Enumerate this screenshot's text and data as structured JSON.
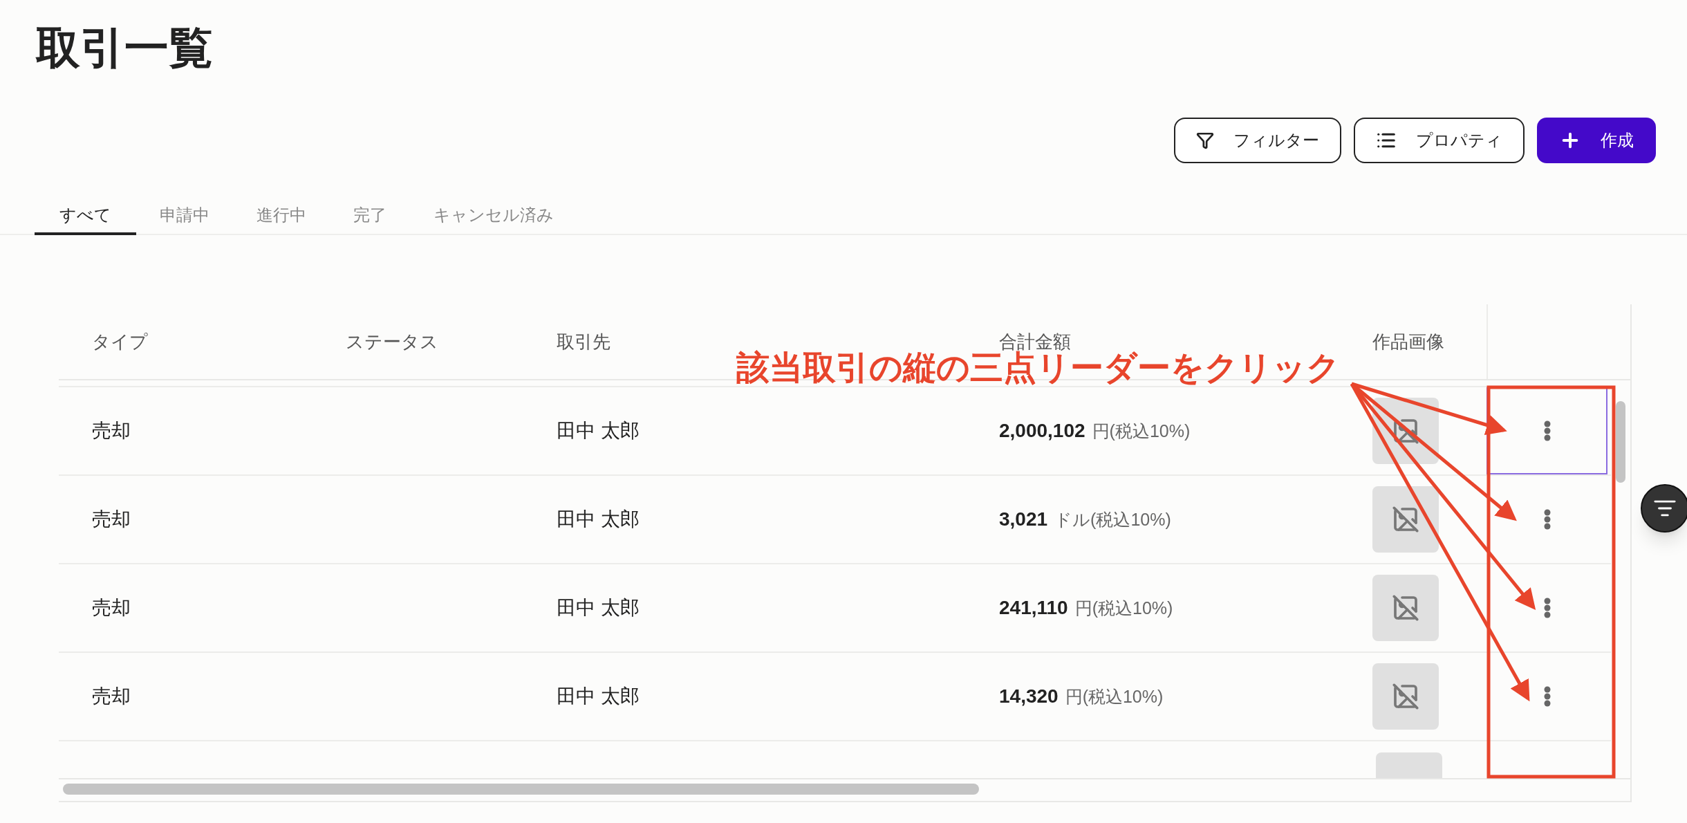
{
  "page_title": "取引一覧",
  "toolbar": [
    {
      "kind": "filter",
      "label": "フィルター"
    },
    {
      "kind": "properties",
      "label": "プロパティ"
    },
    {
      "kind": "create",
      "label": "作成"
    }
  ],
  "tabs": [
    {
      "label": "すべて",
      "selected": true
    },
    {
      "label": "申請中",
      "selected": false
    },
    {
      "label": "進行中",
      "selected": false
    },
    {
      "label": "完了",
      "selected": false
    },
    {
      "label": "キャンセル済み",
      "selected": false
    }
  ],
  "table": {
    "columns": [
      "タイプ",
      "ステータス",
      "取引先",
      "合計金額",
      "作品画像"
    ],
    "rows": [
      {
        "type": "売却",
        "partner": "田中 太郎",
        "amount": "2,000,102",
        "amount_note": "円(税込10%)",
        "selected": true
      },
      {
        "type": "売却",
        "partner": "田中 太郎",
        "amount": "3,021",
        "amount_note": "ドル(税込10%)",
        "selected": false
      },
      {
        "type": "売却",
        "partner": "田中 太郎",
        "amount": "241,110",
        "amount_note": "円(税込10%)",
        "selected": false
      },
      {
        "type": "売却",
        "partner": "田中 太郎",
        "amount": "14,320",
        "amount_note": "円(税込10%)",
        "selected": false
      }
    ]
  },
  "annotation": {
    "text": "該当取引の縦の三点リーダーをクリック"
  }
}
